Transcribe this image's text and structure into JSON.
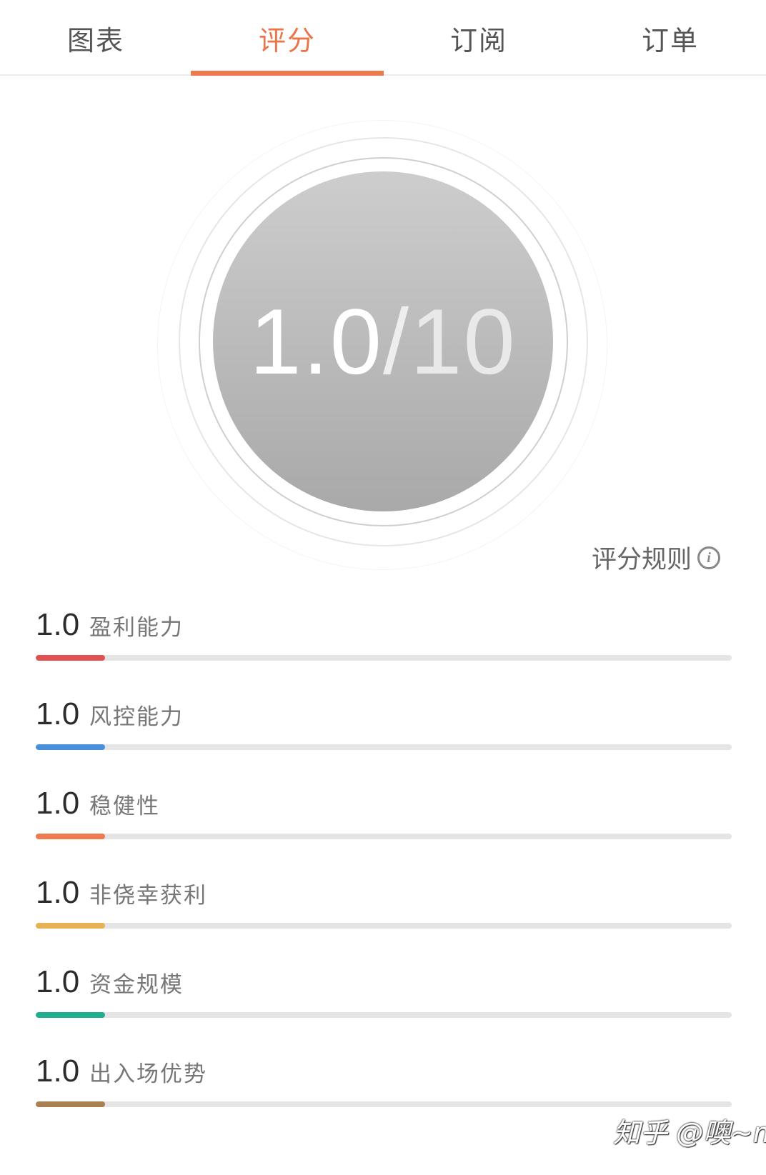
{
  "tabs": [
    {
      "label": "图表"
    },
    {
      "label": "评分"
    },
    {
      "label": "订阅"
    },
    {
      "label": "订单"
    }
  ],
  "active_tab_index": 1,
  "accent_color": "#ec7a4c",
  "score": {
    "value": "1.0",
    "separator": "/",
    "max": "10"
  },
  "rules": {
    "label": "评分规则",
    "icon": "info-icon"
  },
  "metrics": [
    {
      "value": "1.0",
      "label": "盈利能力",
      "color": "#e05252",
      "fraction": 0.1
    },
    {
      "value": "1.0",
      "label": "风控能力",
      "color": "#4a8fdc",
      "fraction": 0.1
    },
    {
      "value": "1.0",
      "label": "稳健性",
      "color": "#ee7a50",
      "fraction": 0.1
    },
    {
      "value": "1.0",
      "label": "非侥幸获利",
      "color": "#e8b155",
      "fraction": 0.1
    },
    {
      "value": "1.0",
      "label": "资金规模",
      "color": "#1fae8f",
      "fraction": 0.1
    },
    {
      "value": "1.0",
      "label": "出入场优势",
      "color": "#a98052",
      "fraction": 0.1
    }
  ],
  "watermark": "知乎 @噢~mk"
}
